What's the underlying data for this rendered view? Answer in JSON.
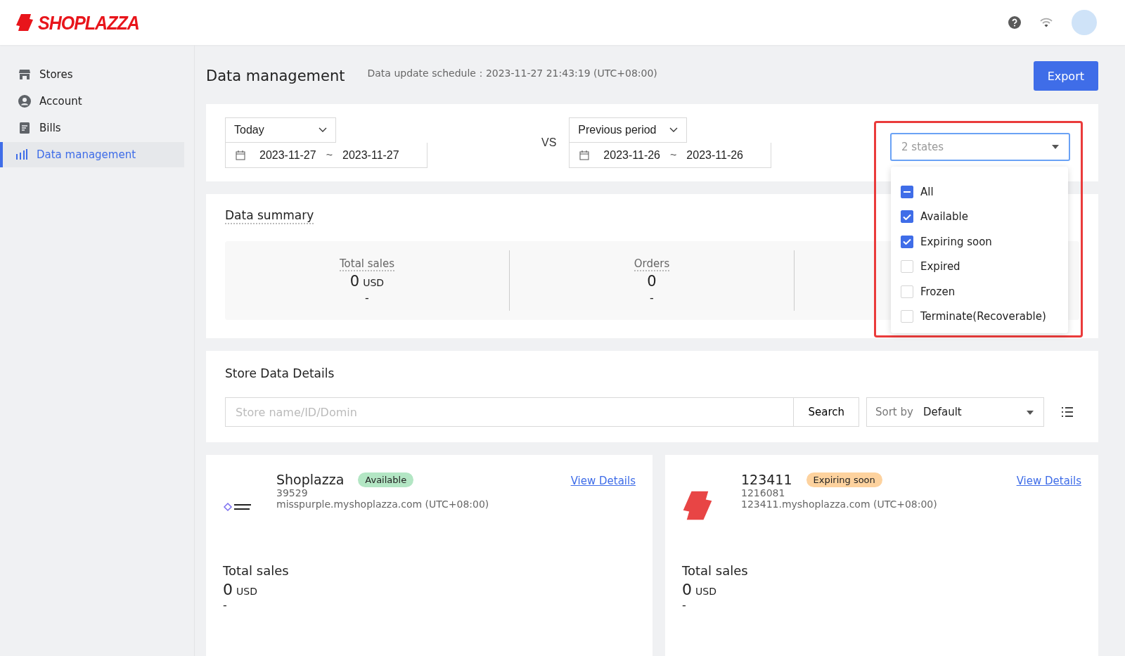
{
  "header": {
    "brand": "SHOPLAZZA"
  },
  "sidebar": {
    "items": [
      {
        "label": "Stores",
        "selected": false
      },
      {
        "label": "Account",
        "selected": false
      },
      {
        "label": "Bills",
        "selected": false
      },
      {
        "label": "Data management",
        "selected": true
      }
    ]
  },
  "page": {
    "title": "Data management",
    "schedule": "Data update schedule：2023-11-27 21:43:19 (UTC+08:00)",
    "export_button": "Export"
  },
  "filters": {
    "period": "Today",
    "range_start": "2023-11-27",
    "range_end": "2023-11-27",
    "range_sep": "~",
    "vs": "VS",
    "compare": "Previous period",
    "compare_start": "2023-11-26",
    "compare_end": "2023-11-26",
    "compare_sep": "~",
    "states_select": {
      "value": "2 states",
      "all": {
        "label": "All",
        "indeterminate": true
      },
      "options": [
        {
          "label": "Available",
          "checked": true
        },
        {
          "label": "Expiring soon",
          "checked": true
        },
        {
          "label": "Expired",
          "checked": false
        },
        {
          "label": "Frozen",
          "checked": false
        },
        {
          "label": "Terminate(Recoverable)",
          "checked": false
        }
      ]
    }
  },
  "summary": {
    "title": "Data summary",
    "metrics": [
      {
        "label": "Total sales",
        "value": "0",
        "unit": "USD",
        "change": "-"
      },
      {
        "label": "Orders",
        "value": "0",
        "change": "-"
      }
    ]
  },
  "store_details": {
    "title": "Store Data Details",
    "search_placeholder": "Store name/ID/Domin",
    "search_button": "Search",
    "sort_label": "Sort by",
    "sort_value": "Default"
  },
  "stores": [
    {
      "name": "Shoplazza",
      "status": "Available",
      "color": "#b3e6c4",
      "id": "39529",
      "domain": "misspurple.myshoplazza.com (UTC+08:00)",
      "link": "View Details",
      "sales_label": "Total sales",
      "sales_value": "0",
      "sales_unit": "USD",
      "sales_change": "-"
    },
    {
      "name": "123411",
      "status": "Expiring soon",
      "color": "#fdd29e",
      "id": "1216081",
      "domain": "123411.myshoplazza.com (UTC+08:00)",
      "link": "View Details",
      "sales_label": "Total sales",
      "sales_value": "0",
      "sales_unit": "USD",
      "sales_change": "-"
    }
  ]
}
